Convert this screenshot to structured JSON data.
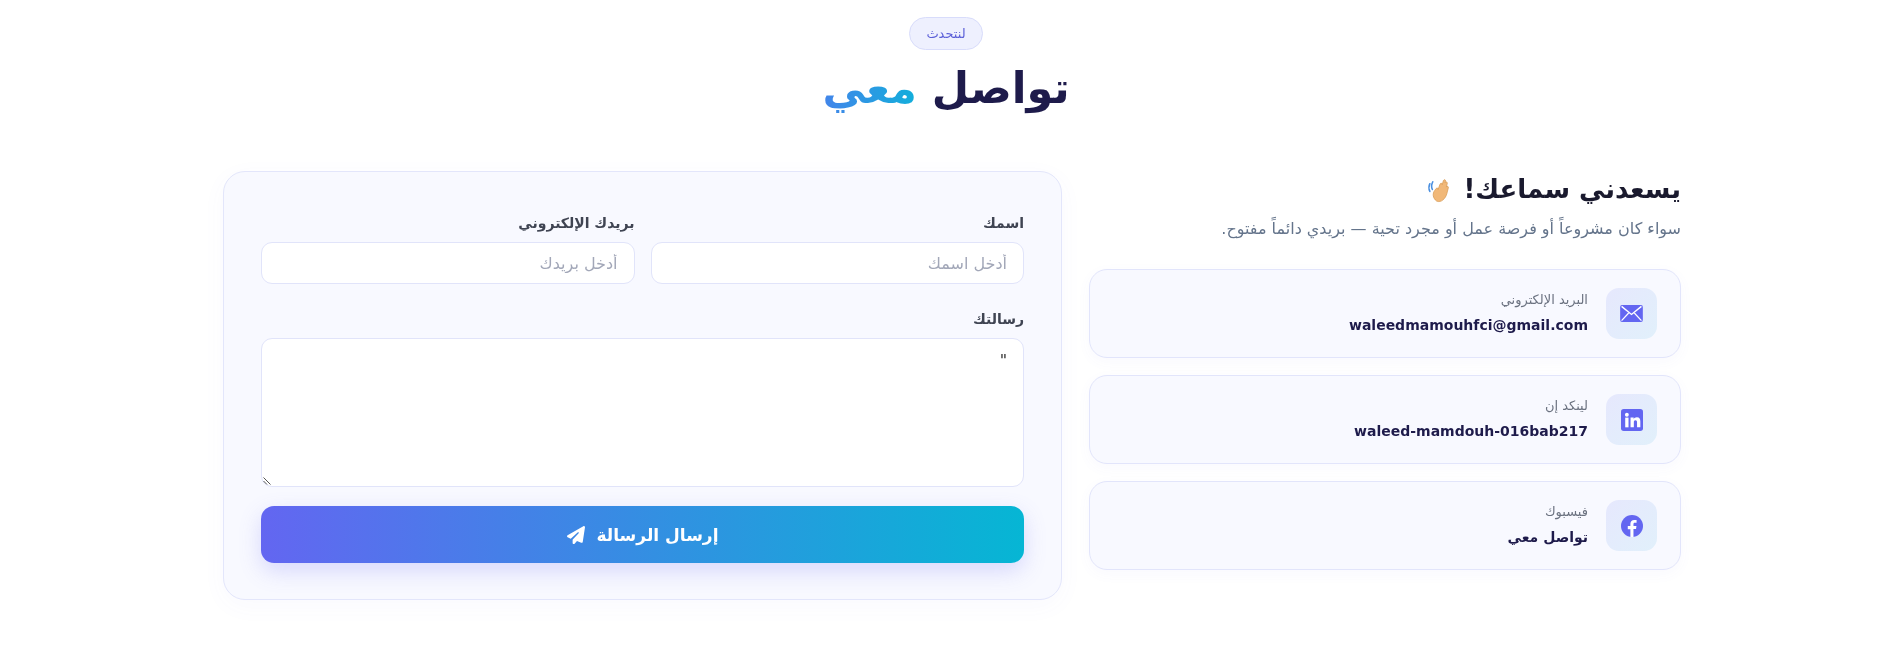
{
  "header": {
    "badge": "لنتحدث",
    "title_parts": [
      {
        "text": "تواصل",
        "highlight": false
      },
      {
        "text": "معي",
        "highlight": true
      }
    ]
  },
  "intro": {
    "title": "يسعدني سماعك!",
    "text": "سواء كان مشروعاً أو فرصة عمل أو مجرد تحية — بريدي دائماً مفتوح."
  },
  "contacts": [
    {
      "kind": "email",
      "label": "البريد الإلكتروني",
      "value": "waleedmamouhfci@gmail.com"
    },
    {
      "kind": "linkedin",
      "label": "لينكد إن",
      "value": "waleed-mamdouh-016bab217"
    },
    {
      "kind": "facebook",
      "label": "فيسبوك",
      "value": "تواصل معي"
    }
  ],
  "form": {
    "fields": [
      {
        "kind": "input",
        "label": "اسمك",
        "placeholder": "أدخل اسمك"
      },
      {
        "kind": "input",
        "label": "بريدك الإلكتروني",
        "placeholder": "أدخل بريدك"
      },
      {
        "kind": "textarea",
        "label": "رسالتك",
        "value": "\""
      }
    ],
    "submit": {
      "label": "إرسال الرسالة"
    }
  }
}
